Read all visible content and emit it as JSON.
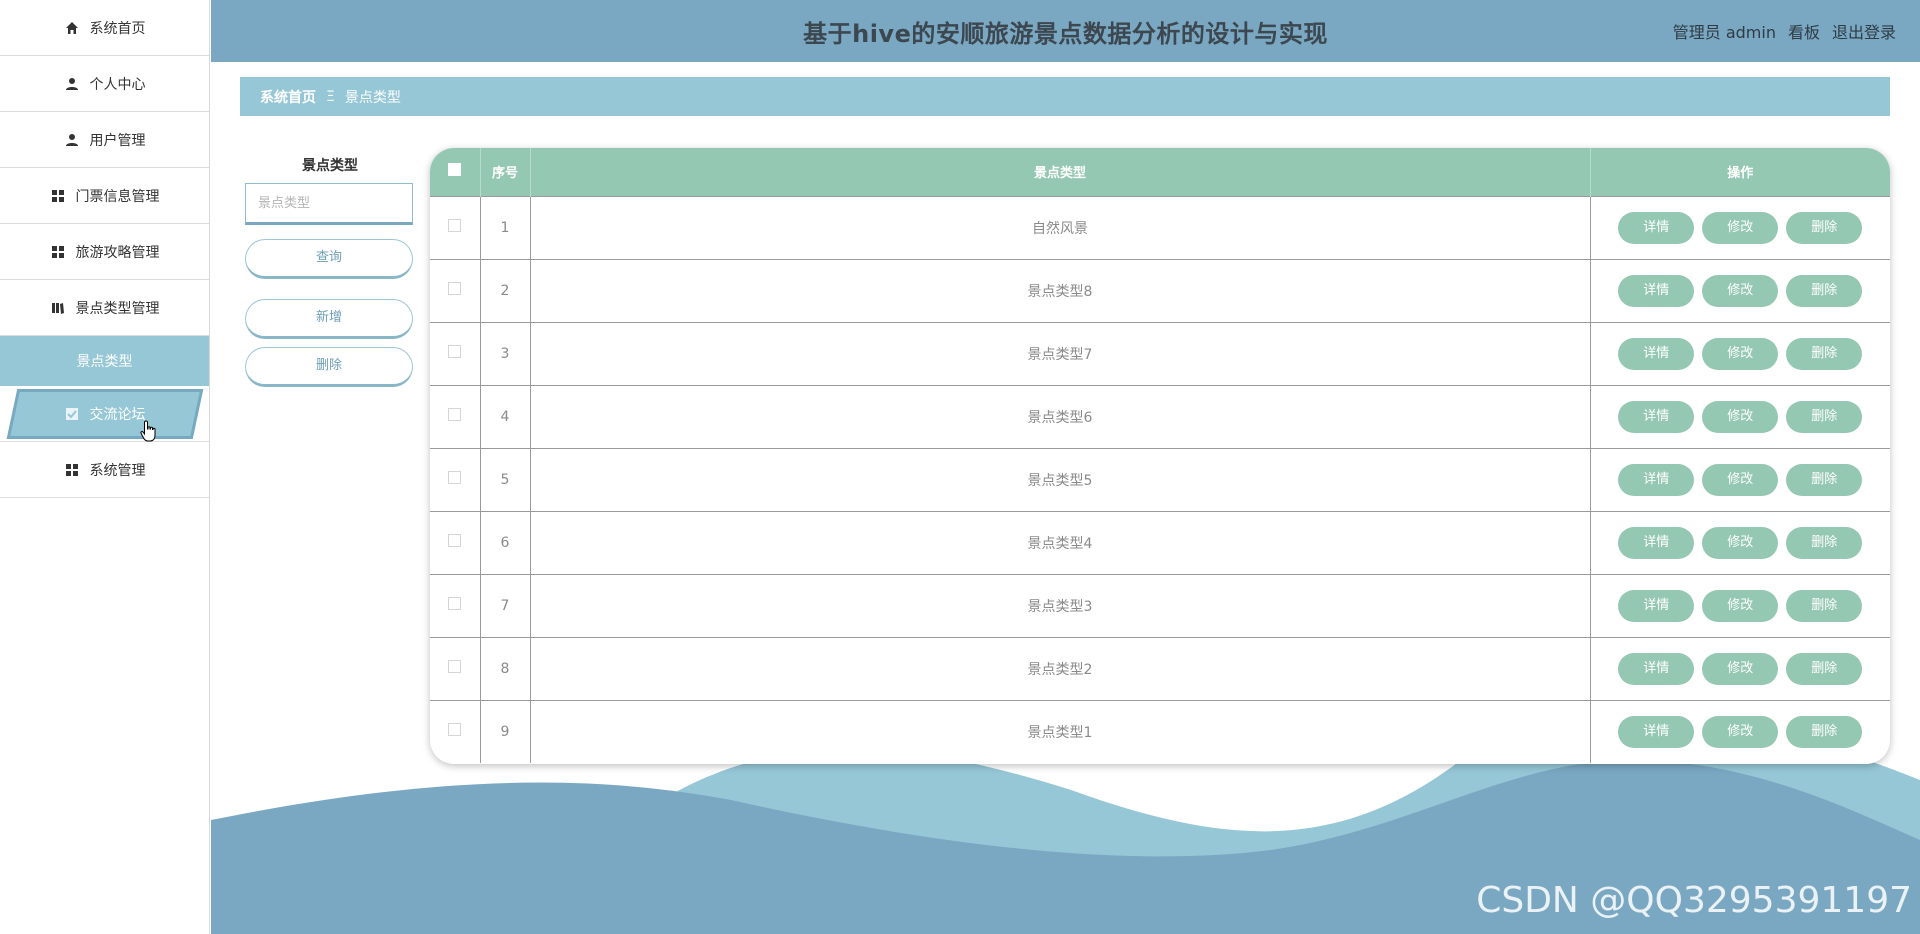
{
  "header": {
    "title": "基于hive的安顺旅游景点数据分析的设计与实现",
    "user_label": "管理员 admin",
    "board_label": "看板",
    "logout_label": "退出登录"
  },
  "sidebar": {
    "items": [
      {
        "label": "系统首页",
        "icon": "home-icon"
      },
      {
        "label": "个人中心",
        "icon": "person-icon"
      },
      {
        "label": "用户管理",
        "icon": "person-icon"
      },
      {
        "label": "门票信息管理",
        "icon": "grid-icon"
      },
      {
        "label": "旅游攻略管理",
        "icon": "grid-icon"
      },
      {
        "label": "景点类型管理",
        "icon": "book-icon"
      }
    ],
    "active_sub": "景点类型",
    "hover_item": {
      "label": "交流论坛",
      "icon": "checkbox-icon"
    },
    "last_item": {
      "label": "系统管理",
      "icon": "grid-icon"
    }
  },
  "breadcrumb": {
    "home": "系统首页",
    "separator": "Ξ",
    "current": "景点类型"
  },
  "search": {
    "label": "景点类型",
    "placeholder": "景点类型",
    "query_button": "查询",
    "add_button": "新增",
    "delete_button": "删除"
  },
  "table": {
    "headers": {
      "index": "序号",
      "type": "景点类型",
      "actions": "操作"
    },
    "action_labels": {
      "detail": "详情",
      "edit": "修改",
      "delete": "删除"
    },
    "rows": [
      {
        "index": "1",
        "type": "自然风景"
      },
      {
        "index": "2",
        "type": "景点类型8"
      },
      {
        "index": "3",
        "type": "景点类型7"
      },
      {
        "index": "4",
        "type": "景点类型6"
      },
      {
        "index": "5",
        "type": "景点类型5"
      },
      {
        "index": "6",
        "type": "景点类型4"
      },
      {
        "index": "7",
        "type": "景点类型3"
      },
      {
        "index": "8",
        "type": "景点类型2"
      },
      {
        "index": "9",
        "type": "景点类型1"
      }
    ]
  },
  "watermark": "CSDN @QQ3295391197",
  "colors": {
    "header_bg": "#7aa8c3",
    "breadcrumb_bg": "#96c7d6",
    "table_header_bg": "#95c8b3",
    "action_button_bg": "#95c8b3"
  }
}
